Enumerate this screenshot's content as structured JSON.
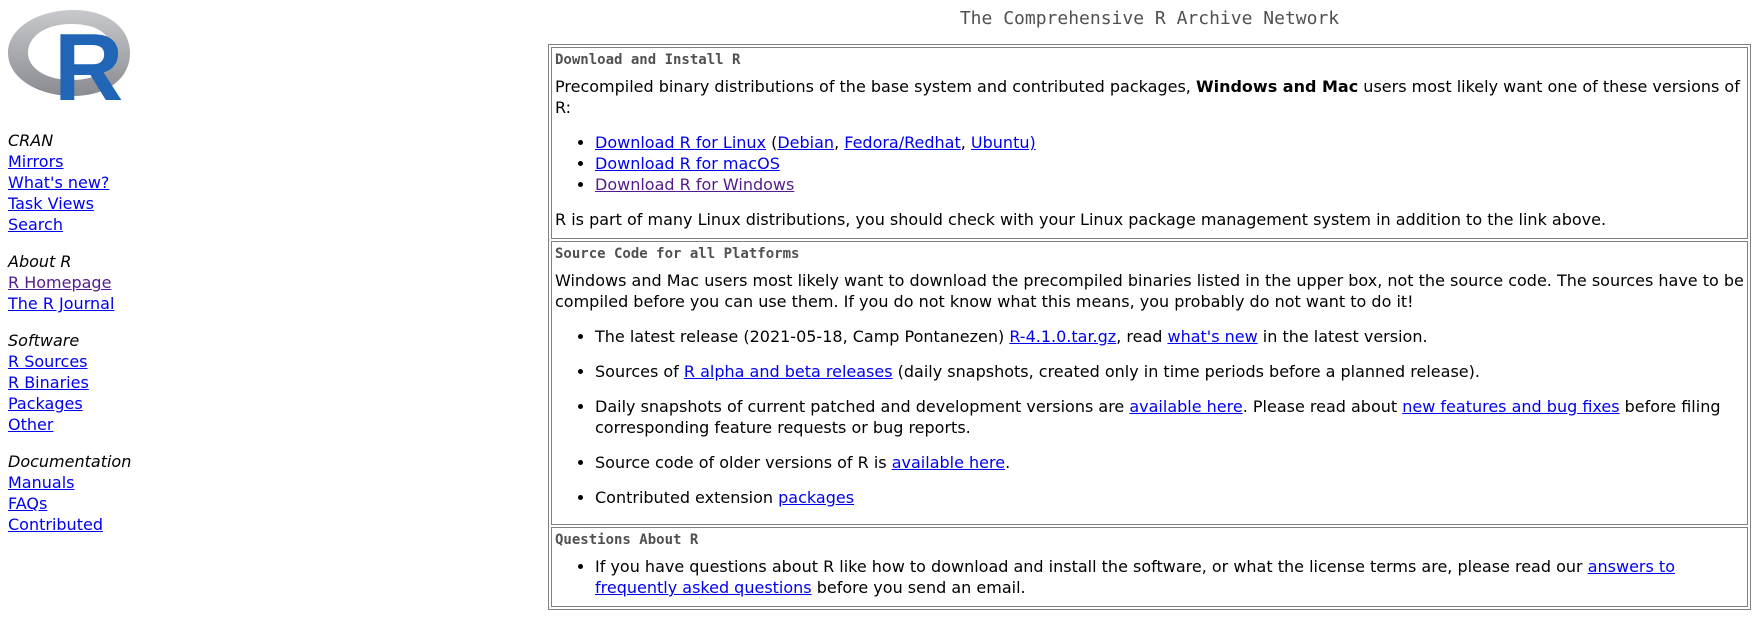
{
  "colors": {
    "link": "#0000ee",
    "visited": "#551a8b",
    "logo_blue": "#2165b6",
    "logo_gray": "#9a9ba0"
  },
  "logo": {
    "letter": "R"
  },
  "header": {
    "title": "The Comprehensive R Archive Network"
  },
  "sidebar": {
    "groups": [
      {
        "heading": "CRAN",
        "links": [
          "Mirrors",
          "What's new?",
          "Task Views",
          "Search"
        ]
      },
      {
        "heading": "About R",
        "links": [
          "R Homepage",
          "The R Journal"
        ]
      },
      {
        "heading": "Software",
        "links": [
          "R Sources",
          "R Binaries",
          "Packages",
          "Other"
        ]
      },
      {
        "heading": "Documentation",
        "links": [
          "Manuals",
          "FAQs",
          "Contributed"
        ]
      }
    ]
  },
  "download": {
    "title": "Download and Install R",
    "intro_pre": "Precompiled binary distributions of the base system and contributed packages, ",
    "intro_bold": "Windows and Mac",
    "intro_post": " users most likely want one of these versions of R:",
    "linux": "Download R for Linux",
    "linux_open": " (",
    "debian": "Debian",
    "sep1": ", ",
    "fedora": "Fedora/Redhat",
    "sep2": ", ",
    "ubuntu": "Ubuntu)",
    "macos": "Download R for macOS",
    "windows": "Download R for Windows",
    "footer": "R is part of many Linux distributions, you should check with your Linux package management system in addition to the link above."
  },
  "source": {
    "title": "Source Code for all Platforms",
    "intro": "Windows and Mac users most likely want to download the precompiled binaries listed in the upper box, not the source code. The sources have to be compiled before you can use them. If you do not know what this means, you probably do not want to do it!",
    "item1_pre": "The latest release (2021-05-18, Camp Pontanezen) ",
    "item1_link": "R-4.1.0.tar.gz",
    "item1_mid": ", read ",
    "item1_link2": "what's new",
    "item1_post": " in the latest version.",
    "item2_pre": "Sources of ",
    "item2_link": "R alpha and beta releases",
    "item2_post": " (daily snapshots, created only in time periods before a planned release).",
    "item3_pre": "Daily snapshots of current patched and development versions are ",
    "item3_link": "available here",
    "item3_mid": ". Please read about ",
    "item3_link2": "new features and bug fixes",
    "item3_post": " before filing corresponding feature requests or bug reports.",
    "item4_pre": "Source code of older versions of R is ",
    "item4_link": "available here",
    "item4_post": ".",
    "item5_pre": "Contributed extension ",
    "item5_link": "packages"
  },
  "questions": {
    "title": "Questions About R",
    "item_pre": "If you have questions about R like how to download and install the software, or what the license terms are, please read our ",
    "item_link": "answers to frequently asked questions",
    "item_post": " before you send an email."
  }
}
